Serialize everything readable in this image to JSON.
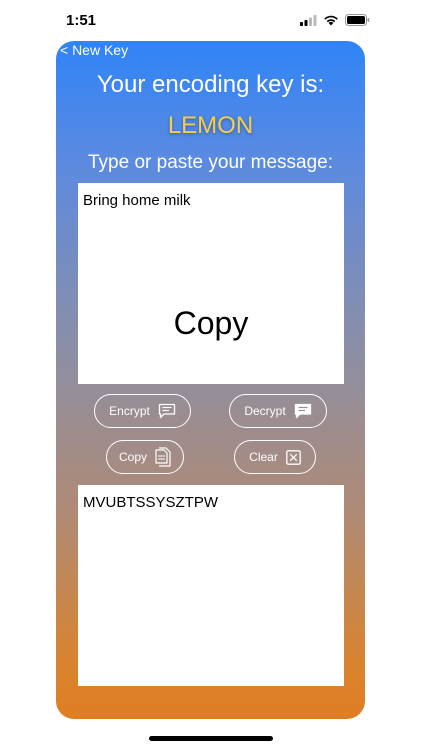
{
  "status_bar": {
    "time": "1:51",
    "signal_icon": "cellular-signal-icon",
    "wifi_icon": "wifi-icon",
    "battery_icon": "battery-icon"
  },
  "nav": {
    "back_label": "< New Key"
  },
  "header": {
    "heading": "Your encoding key is:",
    "key": "LEMON",
    "key_color": "#f6cf4a",
    "prompt": "Type or paste your message:"
  },
  "input": {
    "value": "Bring home milk",
    "overlay_text": "Copy"
  },
  "buttons": {
    "encrypt": {
      "label": "Encrypt",
      "icon": "message-outline-icon"
    },
    "decrypt": {
      "label": "Decrypt",
      "icon": "message-filled-icon"
    },
    "copy": {
      "label": "Copy",
      "icon": "copy-documents-icon"
    },
    "clear": {
      "label": "Clear",
      "icon": "clear-x-box-icon"
    }
  },
  "output": {
    "value": "MVUBTSSYSZTPW"
  },
  "colors": {
    "gradient_top": "#2f84f7",
    "gradient_bottom": "#e07d22"
  }
}
